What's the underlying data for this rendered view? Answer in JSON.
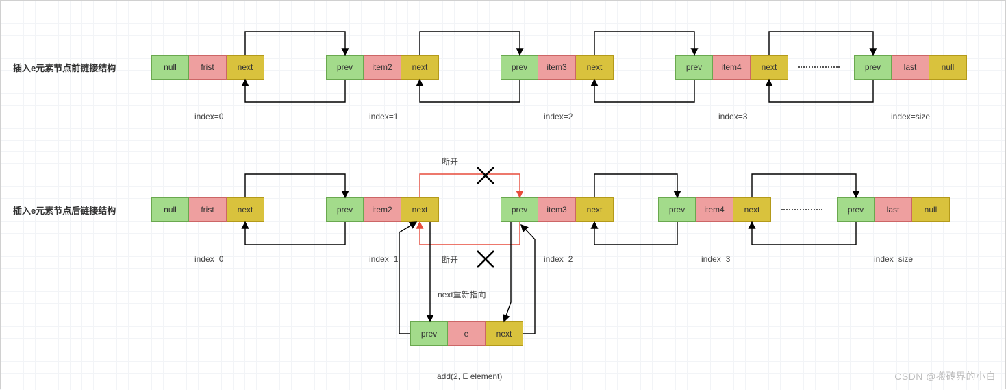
{
  "title_before": "插入e元素节点前链接结构",
  "title_after": "插入e元素节点后链接结构",
  "row1_nodes": [
    {
      "cells": [
        "null",
        "frist",
        "next"
      ],
      "index_label": "index=0"
    },
    {
      "cells": [
        "prev",
        "item2",
        "next"
      ],
      "index_label": "index=1"
    },
    {
      "cells": [
        "prev",
        "item3",
        "next"
      ],
      "index_label": "index=2"
    },
    {
      "cells": [
        "prev",
        "item4",
        "next"
      ],
      "index_label": "index=3"
    },
    {
      "cells": [
        "prev",
        "last",
        "null"
      ],
      "index_label": "index=size"
    }
  ],
  "row2_nodes": [
    {
      "cells": [
        "null",
        "frist",
        "next"
      ],
      "index_label": "index=0"
    },
    {
      "cells": [
        "prev",
        "item2",
        "next"
      ],
      "index_label": "index=1"
    },
    {
      "cells": [
        "prev",
        "item3",
        "next"
      ],
      "index_label": "index=2"
    },
    {
      "cells": [
        "prev",
        "item4",
        "next"
      ],
      "index_label": "index=3"
    },
    {
      "cells": [
        "prev",
        "last",
        "null"
      ],
      "index_label": "index=size"
    }
  ],
  "new_node": {
    "cells": [
      "prev",
      "e",
      "next"
    ]
  },
  "break_label": "断开",
  "repoint_label": "next重新指向",
  "add_call": "add(2, E element)",
  "watermark": "CSDN @搬砖界的小白",
  "colors": {
    "green": "#a3db8b",
    "pink": "#ee9f9f",
    "yellow": "#d9c23d",
    "red_arrow": "#e74c3c",
    "black": "#000000"
  }
}
